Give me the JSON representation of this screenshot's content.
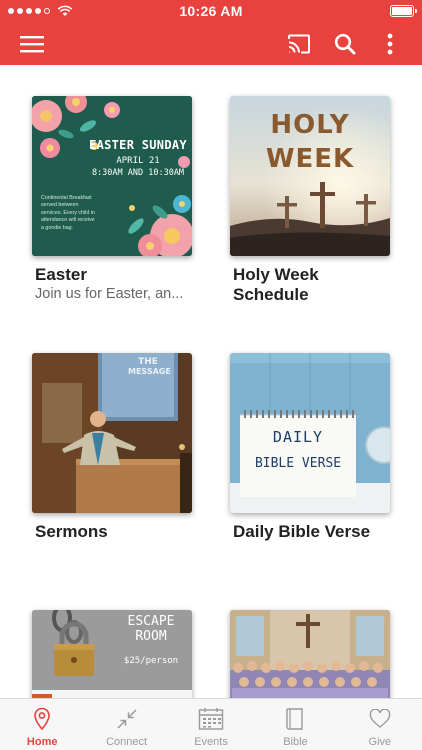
{
  "status_bar": {
    "time": "10:26 AM"
  },
  "app_bar": {
    "icons": [
      "hamburger-menu-icon",
      "cast-icon",
      "search-icon",
      "more-vertical-icon"
    ],
    "color": "#e8423f"
  },
  "cards": [
    {
      "title": "Easter",
      "subtitle": "Join us for Easter, an...",
      "image": {
        "heading": "EASTER SUNDAY",
        "date": "APRIL 21",
        "times": "8:30AM AND 10:30AM",
        "note_lines": [
          "Continental Breakfast",
          "served between",
          "services.  Every child in",
          "attendance will receive",
          "a goodie bag."
        ]
      }
    },
    {
      "title": "Holy Week Schedule",
      "image": {
        "line1": "HOLY",
        "line2": "WEEK"
      }
    },
    {
      "title": "Sermons",
      "image": {
        "screen_line1": "THE",
        "screen_line2": "MESSAGE"
      }
    },
    {
      "title": "Daily Bible Verse",
      "image": {
        "line1": "DAILY",
        "line2": "BIBLE VERSE"
      }
    },
    {
      "title": "",
      "image": {
        "line1": "ESCAPE",
        "line2": "ROOM",
        "price": "$25/person"
      }
    },
    {
      "title": "",
      "image": {}
    }
  ],
  "tab_bar": {
    "tabs": [
      {
        "label": "Home",
        "icon": "location-pin-icon",
        "active": true
      },
      {
        "label": "Connect",
        "icon": "connect-arrows-icon",
        "active": false
      },
      {
        "label": "Events",
        "icon": "calendar-icon",
        "active": false
      },
      {
        "label": "Bible",
        "icon": "book-icon",
        "active": false
      },
      {
        "label": "Give",
        "icon": "heart-icon",
        "active": false
      }
    ],
    "active_color": "#e8423f",
    "inactive_color": "#9a9a9a"
  }
}
